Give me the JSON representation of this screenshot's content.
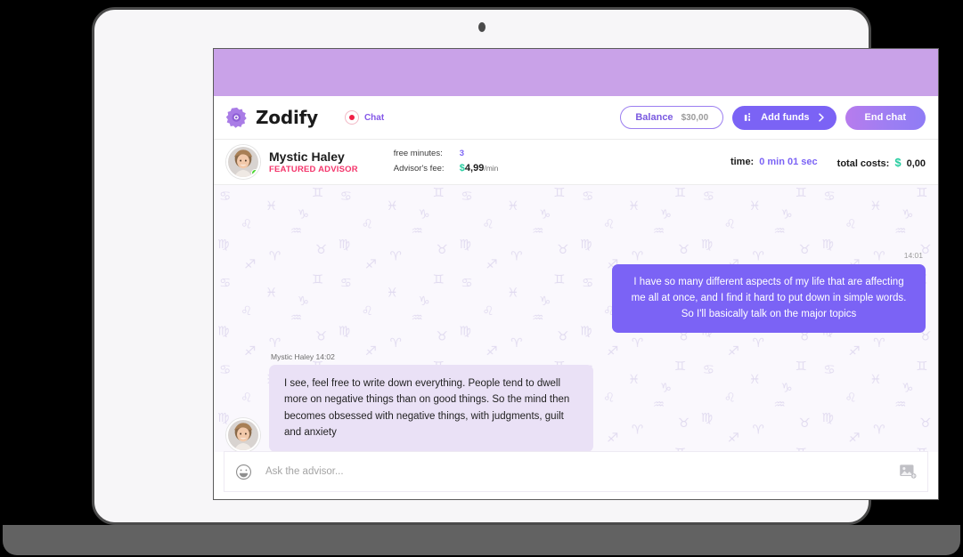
{
  "app": {
    "brand_name": "Zodify",
    "logo_icon": "rosette-logo-icon",
    "chat_status_label": "Chat",
    "rec_indicator_icon": "record-dot-icon"
  },
  "header": {
    "balance_label": "Balance",
    "balance_amount": "$30,00",
    "add_funds_label": "Add funds",
    "add_funds_icon": "wallet-icon",
    "add_funds_chevron_icon": "chevron-right-icon",
    "end_chat_label": "End chat"
  },
  "advisor": {
    "name": "Mystic Haley",
    "badge": "FEATURED ADVISOR",
    "avatar_icon": "advisor-avatar",
    "online_status_icon": "online-dot-icon",
    "free_minutes_label": "free minutes:",
    "free_minutes_value": "3",
    "fee_label": "Advisor's fee:",
    "fee_currency": "$",
    "fee_amount": "4,99",
    "fee_unit": "/min"
  },
  "session": {
    "time_label": "time:",
    "time_value": "0 min 01 sec",
    "total_costs_label": "total costs:",
    "total_costs_currency": "$",
    "total_costs_value": "0,00"
  },
  "chat": {
    "outgoing": {
      "time": "14:01",
      "text": "I have so many different aspects of my life that are affecting me all at once, and I find it hard to put down in simple words. So I'll basically talk on the major topics"
    },
    "incoming": {
      "meta": "Mystic Haley 14:02",
      "text": "I see, feel free to write down everything. People tend to dwell more on negative things than on good things. So the mind then becomes obsessed with negative things, with judgments, guilt and anxiety"
    }
  },
  "composer": {
    "placeholder": "Ask the advisor...",
    "emoji_icon": "smiley-face-icon",
    "attach_icon": "image-attachment-icon"
  },
  "colors": {
    "accent_purple": "#7b63f5",
    "band_purple": "#c9a2e8",
    "badge_pink": "#f4356b",
    "money_green": "#27cda0",
    "chat_bg": "#faf8fd",
    "incoming_bubble": "#eae1f6"
  }
}
